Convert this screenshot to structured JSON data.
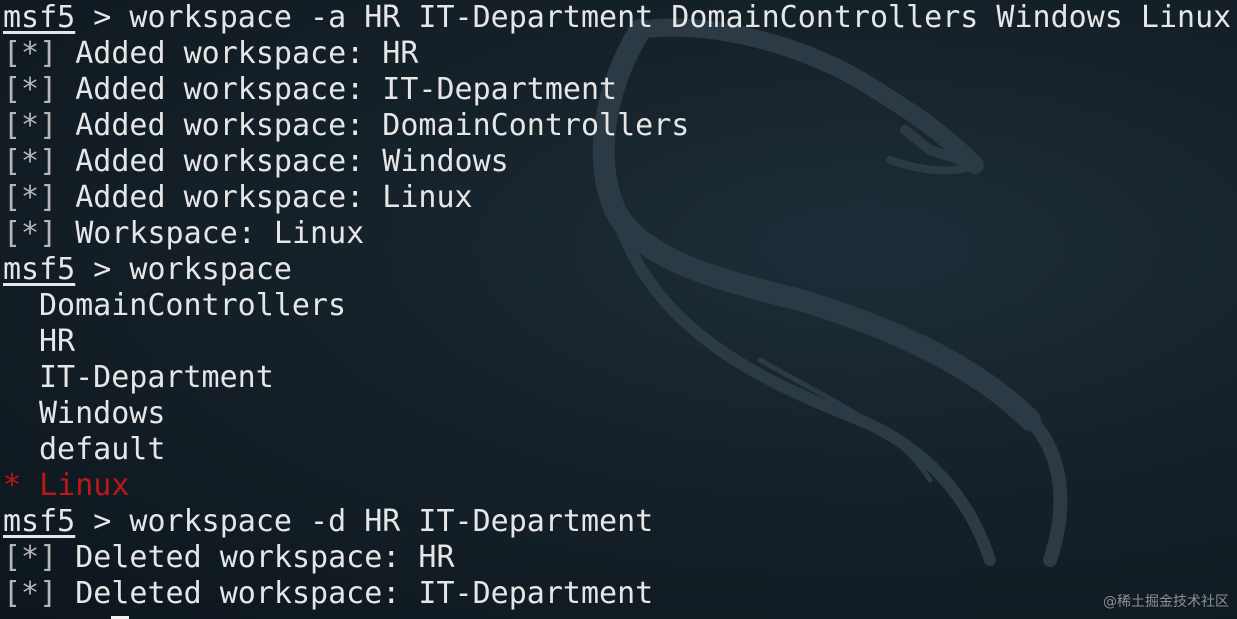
{
  "prompt": "msf5",
  "command_1": " > workspace -a HR IT-Department DomainControllers Windows Linux",
  "added_marker": "[*]",
  "added_prefix": "Added workspace: ",
  "added_workspaces": [
    "HR",
    "IT-Department",
    "DomainControllers",
    "Windows",
    "Linux"
  ],
  "current_workspace_text": "Workspace: Linux",
  "command_2": " > workspace",
  "workspace_list": [
    "DomainControllers",
    "HR",
    "IT-Department",
    "Windows",
    "default"
  ],
  "active_marker": "*",
  "active_workspace": "Linux",
  "active_color": "#b81818",
  "command_3": " > workspace -d HR IT-Department",
  "deleted_prefix": "Deleted workspace: ",
  "deleted_workspaces": [
    "HR",
    "IT-Department"
  ],
  "watermark": "@稀土掘金技术社区"
}
